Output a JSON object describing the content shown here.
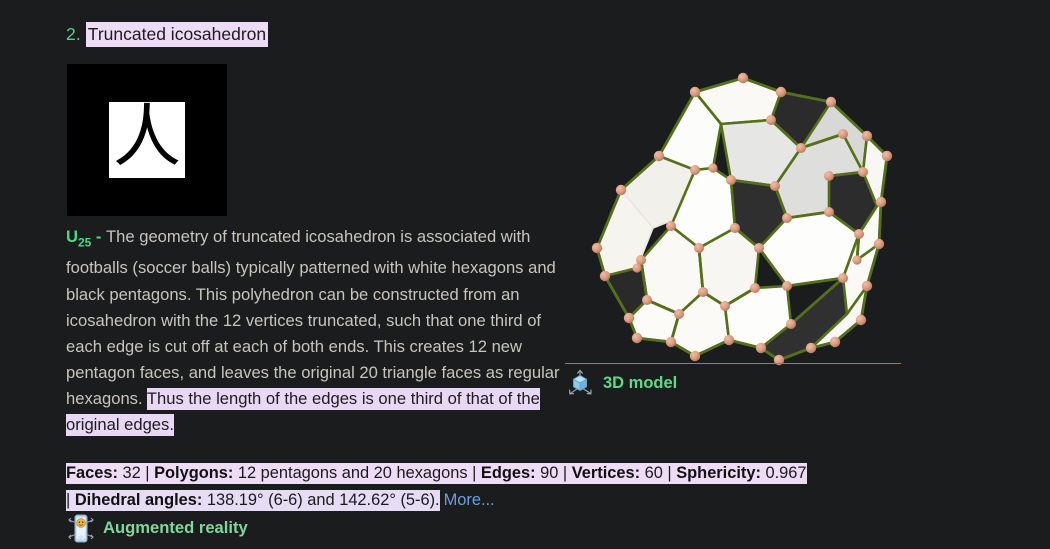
{
  "theme": {
    "background": "#1a1c1e",
    "body_text": "#c9c5bd",
    "accent_green": "#4fd884",
    "link_blue": "#6a9fe0",
    "highlight_lavender": "#eedcf7",
    "highlight_lavender_alt": "#e6dcf5",
    "rule_green": "#5e9a64",
    "edge_olive": "#55701a",
    "vertex_salmon": "#d99a7f",
    "face_white": "#fdfdfb",
    "face_dark": "#2e2e2e"
  },
  "entry": {
    "number": "2.",
    "title": "Truncated icosahedron"
  },
  "thumbnail": {
    "glyph": "人",
    "alt_name": "truncated-icosahedron-thumbnail"
  },
  "description": {
    "u_label": "U",
    "u_sub": "25",
    "u_dash": " - ",
    "body": "The geometry of truncated icosahedron is associated with footballs (soccer balls) typically patterned with white hexagons and black pentagons. This polyhedron can be constructed from an icosahedron with the 12 vertices truncated, such that one third of each edge is cut off at each of both ends. This creates 12 new pentagon faces, and leaves the original 20 triangle faces as regular hexagons. ",
    "highlighted_sentence": "Thus the length of the edges is one third of that of the original edges."
  },
  "model_viewer": {
    "label": "3D model",
    "icon": "cube-3d-axes-icon"
  },
  "augmented_reality": {
    "label": "Augmented reality",
    "icon": "ar-phone-icon"
  },
  "stats": {
    "line1": {
      "faces_label": "Faces:",
      "faces_value": " 32 ",
      "sep1": "| ",
      "polygons_label": "Polygons:",
      "polygons_value": " 12 pentagons and 20 hexagons ",
      "sep2": "| ",
      "edges_label": "Edges:",
      "edges_value": " 90 ",
      "sep3": "| ",
      "vertices_label": "Vertices:",
      "vertices_value": " 60 ",
      "sep4": "| ",
      "sphericity_label": "Sphericity:",
      "sphericity_value": " 0.967"
    },
    "line2": {
      "sep_lead": "| ",
      "dihedral_label": "Dihedral angles:",
      "dihedral_value": " 138.19° (6-6) and 142.62° (5-6).",
      "more_label": "More..."
    }
  }
}
